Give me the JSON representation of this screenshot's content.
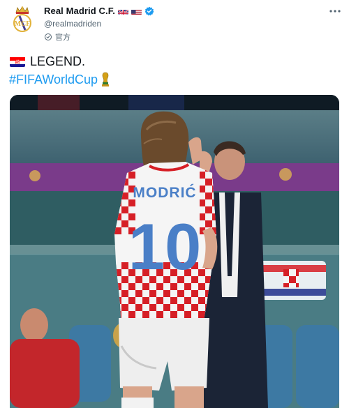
{
  "account": {
    "display_name": "Real Madrid C.F.",
    "handle": "@realmadriden",
    "label": "官方",
    "verified_icon": "verified-badge-icon",
    "flags": [
      "uk-flag-icon",
      "us-flag-icon"
    ]
  },
  "tweet": {
    "line1_text": "LEGEND.",
    "hashtag": "#FIFAWorldCup",
    "line1_icon": "croatia-flag-icon",
    "hashtag_icon": "world-cup-trophy-icon"
  },
  "photo": {
    "jersey_name": "MODRIĆ",
    "jersey_number": "10"
  },
  "colors": {
    "link_blue": "#1d9bf0",
    "verified_blue": "#1d9bf0",
    "secondary_text": "#536471"
  }
}
